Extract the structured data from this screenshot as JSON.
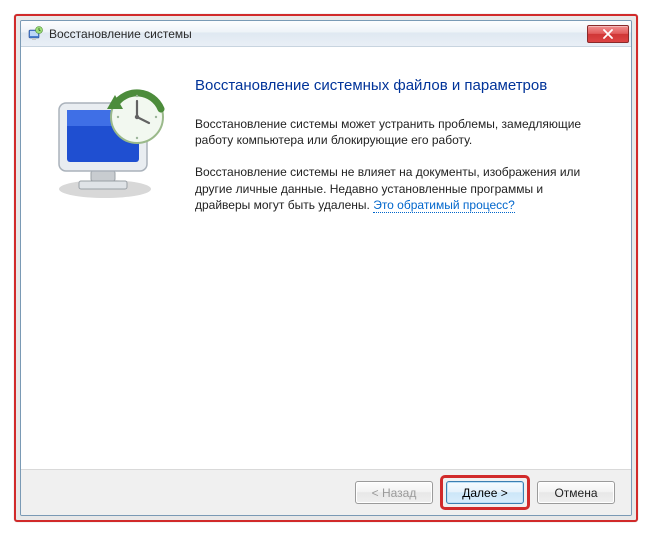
{
  "window": {
    "title": "Восстановление системы"
  },
  "content": {
    "heading": "Восстановление системных файлов и параметров",
    "para1": "Восстановление системы может устранить проблемы, замедляющие работу компьютера или блокирующие его работу.",
    "para2_prefix": "Восстановление системы не влияет на документы, изображения или другие личные данные. Недавно установленные программы и драйверы могут быть удалены. ",
    "para2_link": "Это обратимый процесс?"
  },
  "footer": {
    "back": "< Назад",
    "next": "Далее >",
    "cancel": "Отмена"
  }
}
